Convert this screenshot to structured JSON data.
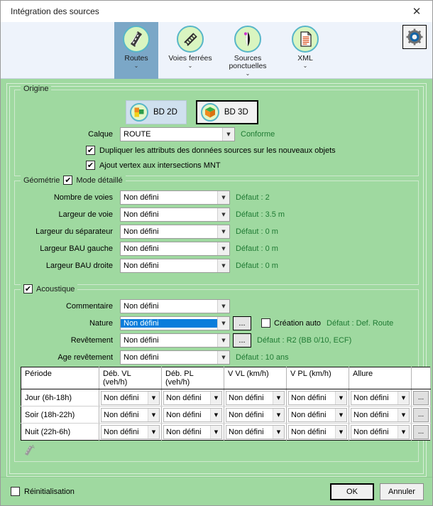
{
  "window": {
    "title": "Intégration des sources",
    "close_label": "✕",
    "bg_color": "#9fd9a0",
    "accent_color": "#0a7ddb",
    "hint_color": "#1f7a33"
  },
  "toolbar": {
    "items": [
      {
        "label": "Routes",
        "icon": "road-icon",
        "caret": "⌄",
        "active": true
      },
      {
        "label": "Voies\nferrées",
        "icon": "railway-icon",
        "caret": "⌄",
        "active": false
      },
      {
        "label": "Sources\nponctuelles",
        "icon": "point-source-icon",
        "caret": "⌄",
        "active": false
      },
      {
        "label": "XML",
        "icon": "xml-document-icon",
        "caret": "⌄",
        "active": false
      }
    ],
    "settings_icon": "gear-icon"
  },
  "origine": {
    "legend": "Origine",
    "bd2d": {
      "label": "BD 2D",
      "icon": "squares-2d-icon",
      "state": "pressed"
    },
    "bd3d": {
      "label": "BD 3D",
      "icon": "cube-3d-icon",
      "state": "focused"
    },
    "calque": {
      "label": "Calque",
      "value": "ROUTE",
      "hint": "Conforme"
    },
    "checkboxes": [
      {
        "label": "Dupliquer les attributs des données sources sur les nouveaux objets",
        "checked": true,
        "mark": "✔"
      },
      {
        "label": "Ajout vertex aux intersections MNT",
        "checked": true,
        "mark": "✔"
      }
    ]
  },
  "geometrie": {
    "legend": "Géométrie",
    "mode_detaille": {
      "label": "Mode détaillé",
      "checked": true,
      "mark": "✔"
    },
    "rows": [
      {
        "label": "Nombre de voies",
        "value": "Non défini",
        "hint": "Défaut : 2"
      },
      {
        "label": "Largeur de voie",
        "value": "Non défini",
        "hint": "Défaut : 3.5 m"
      },
      {
        "label": "Largeur du séparateur",
        "value": "Non défini",
        "hint": "Défaut : 0 m"
      },
      {
        "label": "Largeur BAU gauche",
        "value": "Non défini",
        "hint": "Défaut : 0 m"
      },
      {
        "label": "Largeur BAU droite",
        "value": "Non défini",
        "hint": "Défaut : 0 m"
      }
    ]
  },
  "acoustique": {
    "legend": "Acoustique",
    "checked": true,
    "mark": "✔",
    "rows": [
      {
        "label": "Commentaire",
        "value": "Non défini",
        "selected": false,
        "dots": false,
        "dots_label": "...",
        "hint": ""
      },
      {
        "label": "Nature",
        "value": "Non défini",
        "selected": true,
        "dots": true,
        "dots_label": "...",
        "hint": "Défaut : Def. Route"
      },
      {
        "label": "Revêtement",
        "value": "Non défini",
        "selected": false,
        "dots": true,
        "dots_label": "...",
        "hint": "Défaut : R2 (BB 0/10, ECF)"
      },
      {
        "label": "Age revêtement",
        "value": "Non défini",
        "selected": false,
        "dots": false,
        "dots_label": "...",
        "hint": "Défaut : 10 ans"
      }
    ],
    "creation_auto": {
      "label": "Création auto",
      "checked": false,
      "mark": ""
    },
    "table": {
      "headers": [
        "Période",
        "Déb. VL\n(veh/h)",
        "Déb. PL\n(veh/h)",
        "V VL (km/h)",
        "V PL (km/h)",
        "Allure",
        ""
      ],
      "rows": [
        {
          "period": "Jour (6h-18h)",
          "deb_vl": "Non défini",
          "deb_pl": "Non défini",
          "v_vl": "Non défini",
          "v_pl": "Non défini",
          "allure": "Non défini",
          "dots": "..."
        },
        {
          "period": "Soir (18h-22h)",
          "deb_vl": "Non défini",
          "deb_pl": "Non défini",
          "v_vl": "Non défini",
          "v_pl": "Non défini",
          "allure": "Non défini",
          "dots": "..."
        },
        {
          "period": "Nuit (22h-6h)",
          "deb_vl": "Non défini",
          "deb_pl": "Non défini",
          "v_vl": "Non défini",
          "v_pl": "Non défini",
          "allure": "Non défini",
          "dots": "..."
        }
      ]
    },
    "annotation_icon": "road-label-icon"
  },
  "footer": {
    "reinit": {
      "label": "Réinitialisation",
      "checked": false,
      "mark": ""
    },
    "ok_label": "OK",
    "cancel_label": "Annuler"
  }
}
